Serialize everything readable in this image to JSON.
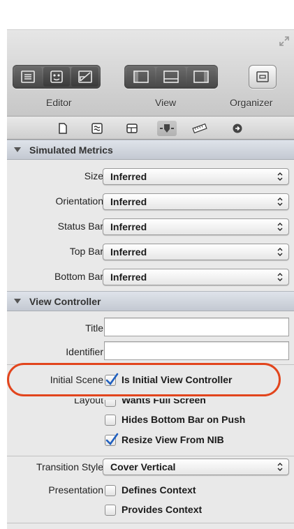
{
  "toolbar": {
    "editor_label": "Editor",
    "view_label": "View",
    "organizer_label": "Organizer"
  },
  "inspector_tabs": [
    "file-icon",
    "quick-help-icon",
    "identity-icon",
    "attributes-icon",
    "size-icon",
    "connections-icon"
  ],
  "simulated_metrics": {
    "header": "Simulated Metrics",
    "rows": [
      {
        "label": "Size",
        "value": "Inferred"
      },
      {
        "label": "Orientation",
        "value": "Inferred"
      },
      {
        "label": "Status Bar",
        "value": "Inferred"
      },
      {
        "label": "Top Bar",
        "value": "Inferred"
      },
      {
        "label": "Bottom Bar",
        "value": "Inferred"
      }
    ]
  },
  "view_controller": {
    "header": "View Controller",
    "title_label": "Title",
    "title_value": "",
    "identifier_label": "Identifier",
    "identifier_value": "",
    "initial_scene_label": "Initial Scene",
    "is_initial_label": "Is Initial View Controller",
    "is_initial_checked": true,
    "layout_label": "Layout",
    "wants_full_screen_label": "Wants Full Screen",
    "wants_full_screen_checked": false,
    "hides_bottom_bar_label": "Hides Bottom Bar on Push",
    "hides_bottom_bar_checked": false,
    "resize_view_label": "Resize View From NIB",
    "resize_view_checked": true,
    "transition_style_label": "Transition Style",
    "transition_style_value": "Cover Vertical",
    "presentation_label": "Presentation",
    "defines_context_label": "Defines Context",
    "defines_context_checked": false,
    "provides_context_label": "Provides Context",
    "provides_context_checked": false
  },
  "colors": {
    "highlight": "#e2451d",
    "checkmark": "#1f5fbf",
    "section_header": "#c4c9d2"
  }
}
